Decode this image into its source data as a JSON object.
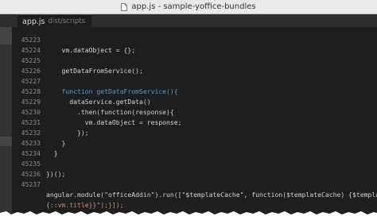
{
  "window": {
    "title": "app.js - sample-yoffice-bundles",
    "file_icon": "file-icon"
  },
  "tab": {
    "filename": "app.js",
    "path": "dist/scripts"
  },
  "editor": {
    "lines": [
      {
        "num": "45223",
        "text": "    vm.dataObject = {};"
      },
      {
        "num": "45224",
        "text": ""
      },
      {
        "num": "45225",
        "text": "    getDataFromService();"
      },
      {
        "num": "45226",
        "text": ""
      },
      {
        "num": "45227",
        "text": "    function getDataFromService(){"
      },
      {
        "num": "45228",
        "text": "      dataService.getData()"
      },
      {
        "num": "45229",
        "text": "        .then(function(response){"
      },
      {
        "num": "45230",
        "text": "          vm.dataObject = response;"
      },
      {
        "num": "45231",
        "text": "        });"
      },
      {
        "num": "45232",
        "text": "    }"
      },
      {
        "num": "45233",
        "text": "  }"
      },
      {
        "num": "45234",
        "text": ""
      },
      {
        "num": "45235",
        "text": "})();"
      },
      {
        "num": "45236",
        "text": ""
      },
      {
        "num": "45237",
        "text": "angular.module(\"officeAddin\").run([\"$templateCache\", function($templateCache) {$templateCache"
      },
      {
        "num": "",
        "text": "{::vm.title}}\");}]);"
      }
    ]
  },
  "colors": {
    "keyword": "#569cd6",
    "string": "#ce9178",
    "function": "#dcdcaa",
    "text": "#d4d4d4",
    "background": "#1e1e1e"
  }
}
